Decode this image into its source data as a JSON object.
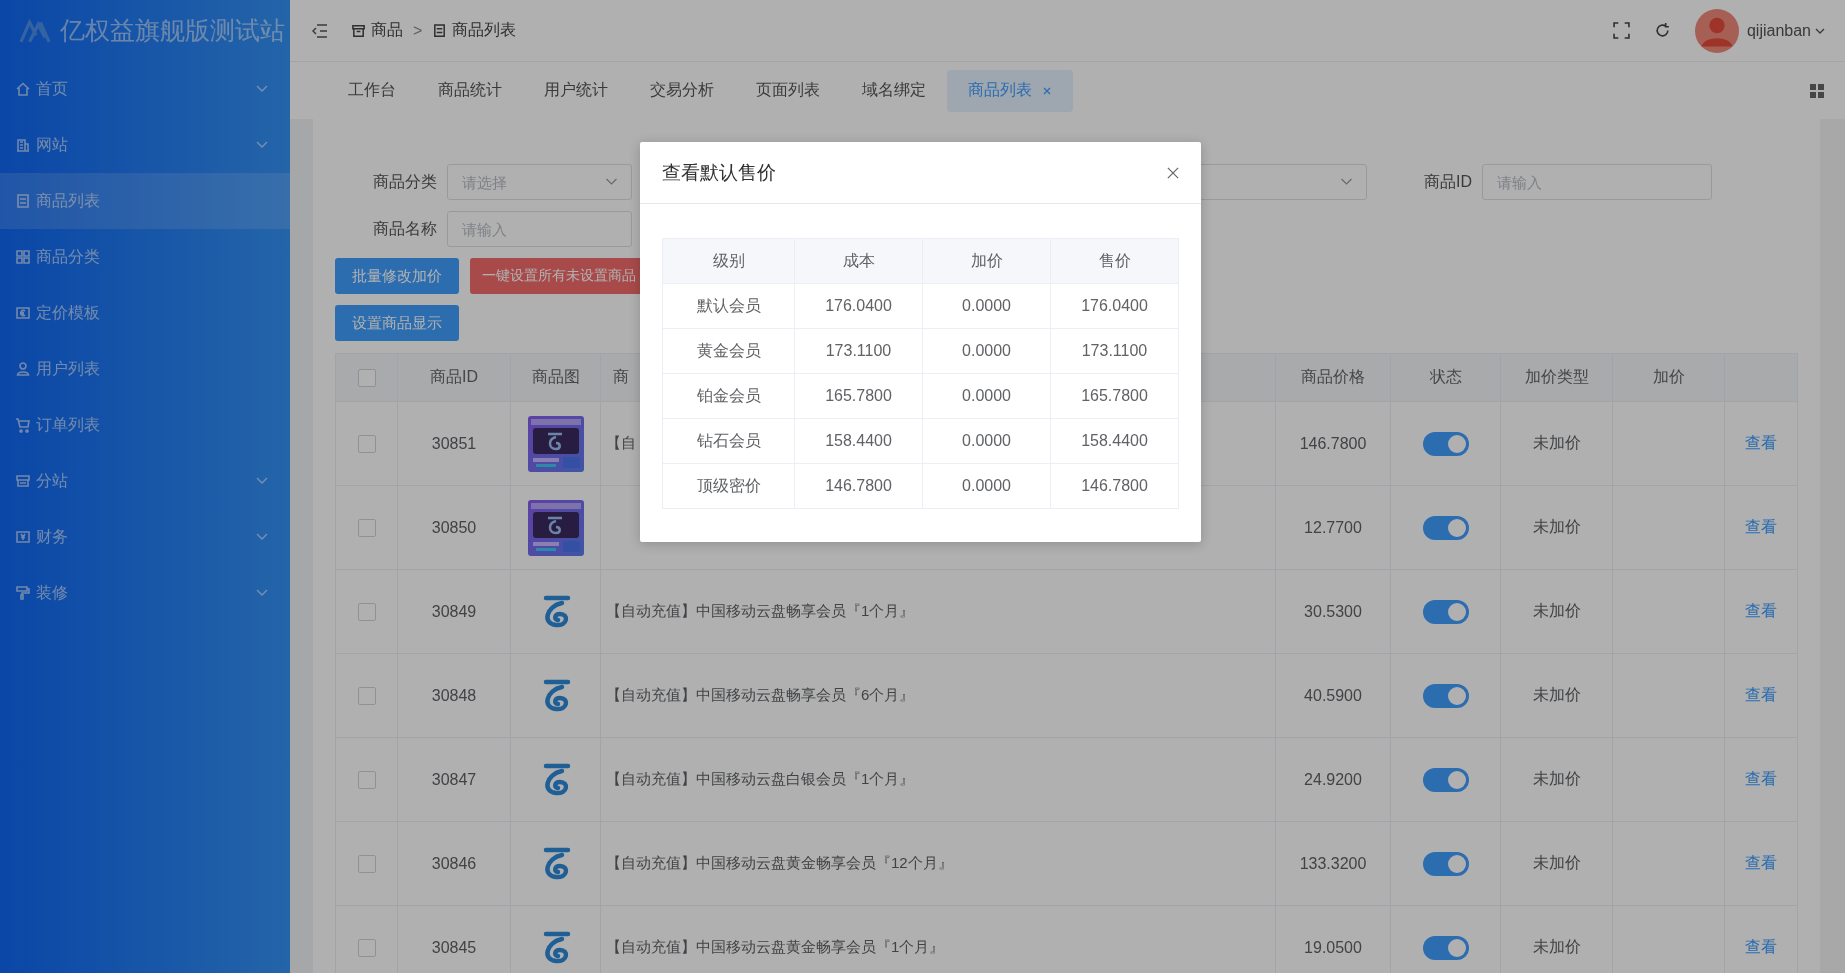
{
  "sidebar": {
    "title": "亿权益旗舰版测试站",
    "items": [
      {
        "label": "首页",
        "expandable": true,
        "selected": false
      },
      {
        "label": "网站",
        "expandable": true,
        "selected": false
      },
      {
        "label": "商品列表",
        "expandable": false,
        "selected": true
      },
      {
        "label": "商品分类",
        "expandable": false,
        "selected": false
      },
      {
        "label": "定价模板",
        "expandable": false,
        "selected": false
      },
      {
        "label": "用户列表",
        "expandable": false,
        "selected": false
      },
      {
        "label": "订单列表",
        "expandable": false,
        "selected": false
      },
      {
        "label": "分站",
        "expandable": true,
        "selected": false
      },
      {
        "label": "财务",
        "expandable": true,
        "selected": false
      },
      {
        "label": "装修",
        "expandable": true,
        "selected": false
      }
    ]
  },
  "topbar": {
    "breadcrumb": [
      "商品",
      "商品列表"
    ],
    "separator": ">",
    "user": "qijianban"
  },
  "tabs": [
    {
      "label": "工作台",
      "selected": false,
      "closable": false
    },
    {
      "label": "商品统计",
      "selected": false,
      "closable": false
    },
    {
      "label": "用户统计",
      "selected": false,
      "closable": false
    },
    {
      "label": "交易分析",
      "selected": false,
      "closable": false
    },
    {
      "label": "页面列表",
      "selected": false,
      "closable": false
    },
    {
      "label": "域名绑定",
      "selected": false,
      "closable": false
    },
    {
      "label": "商品列表",
      "selected": true,
      "closable": true
    }
  ],
  "filters": [
    [
      {
        "label": "商品分类",
        "kind": "select",
        "placeholder": "请选择"
      },
      {
        "kind": "select"
      },
      {
        "label": "商品ID",
        "kind": "input",
        "placeholder": "请输入"
      }
    ],
    [
      {
        "label": "商品名称",
        "kind": "input",
        "placeholder": "请输入"
      }
    ]
  ],
  "buttons": [
    [
      {
        "label": "批量修改加价",
        "kind": "primary"
      },
      {
        "label": "一键设置所有未设置商品",
        "kind": "danger"
      }
    ],
    [
      {
        "label": "设置商品显示",
        "kind": "primary"
      }
    ]
  ],
  "table": {
    "header_checked": false,
    "columns": [
      {
        "label": "商品ID"
      },
      {
        "label": "商品图"
      },
      {
        "label": "商"
      },
      {
        "label": "商品价格"
      },
      {
        "label": "状态"
      },
      {
        "label": "加价类型"
      },
      {
        "label": "加价"
      }
    ],
    "rows": [
      {
        "checked": false,
        "id": "30851",
        "image": {
          "kind": "card"
        },
        "name": "【自",
        "price": "146.7800",
        "on": true,
        "markup_type": "未加价",
        "action": "查看"
      },
      {
        "checked": false,
        "id": "30850",
        "image": {
          "kind": "card"
        },
        "price": "12.7700",
        "on": true,
        "markup_type": "未加价",
        "action": "查看"
      },
      {
        "checked": false,
        "id": "30849",
        "image": {
          "kind": "logo"
        },
        "name": "【自动充值】中国移动云盘畅享会员『1个月』",
        "price": "30.5300",
        "on": true,
        "markup_type": "未加价",
        "action": "查看"
      },
      {
        "checked": false,
        "id": "30848",
        "image": {
          "kind": "logo"
        },
        "name": "【自动充值】中国移动云盘畅享会员『6个月』",
        "price": "40.5900",
        "on": true,
        "markup_type": "未加价",
        "action": "查看"
      },
      {
        "checked": false,
        "id": "30847",
        "image": {
          "kind": "logo"
        },
        "name": "【自动充值】中国移动云盘白银会员『1个月』",
        "price": "24.9200",
        "on": true,
        "markup_type": "未加价",
        "action": "查看"
      },
      {
        "checked": false,
        "id": "30846",
        "image": {
          "kind": "logo"
        },
        "name": "【自动充值】中国移动云盘黄金畅享会员『12个月』",
        "price": "133.3200",
        "on": true,
        "markup_type": "未加价",
        "action": "查看"
      },
      {
        "checked": false,
        "id": "30845",
        "image": {
          "kind": "logo"
        },
        "name": "【自动充值】中国移动云盘黄金畅享会员『1个月』",
        "price": "19.0500",
        "on": true,
        "markup_type": "未加价",
        "action": "查看"
      }
    ]
  },
  "modal": {
    "title": "查看默认售价",
    "columns": [
      "级别",
      "成本",
      "加价",
      "售价"
    ],
    "rows": [
      [
        "默认会员",
        "176.0400",
        "0.0000",
        "176.0400"
      ],
      [
        "黄金会员",
        "173.1100",
        "0.0000",
        "173.1100"
      ],
      [
        "铂金会员",
        "165.7800",
        "0.0000",
        "165.7800"
      ],
      [
        "钻石会员",
        "158.4400",
        "0.0000",
        "158.4400"
      ],
      [
        "顶级密价",
        "146.7800",
        "0.0000",
        "146.7800"
      ]
    ]
  }
}
